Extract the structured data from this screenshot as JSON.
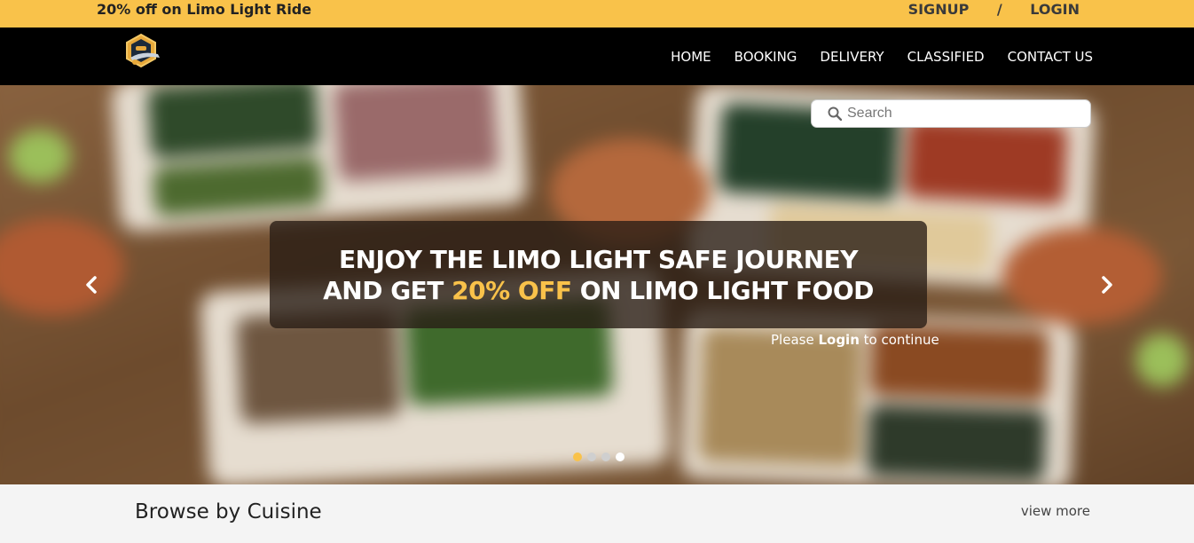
{
  "topbar": {
    "promo": "20% off on Limo Light Ride",
    "signup": "SIGNUP",
    "separator": "/",
    "login": "LOGIN"
  },
  "nav": {
    "logo_icon": "limo-light-logo-icon",
    "items": [
      "HOME",
      "BOOKING",
      "DELIVERY",
      "CLASSIFIED",
      "CONTACT US"
    ]
  },
  "hero": {
    "search_placeholder": "Search",
    "headline_line1": "ENJOY THE LIMO LIGHT SAFE JOURNEY",
    "headline_line2_prefix": "AND GET ",
    "headline_line2_accent": "20% OFF",
    "headline_line2_suffix": " ON LIMO LIGHT FOOD",
    "login_prefix": "Please ",
    "login_link": "Login",
    "login_suffix": " to continue",
    "carousel_dots": 4,
    "active_dot": 4
  },
  "browse": {
    "title": "Browse by Cuisine",
    "view_more": "view more"
  },
  "colors": {
    "accent": "#f9c24a",
    "navbar": "#000000",
    "caption_bg": "#281c14"
  }
}
